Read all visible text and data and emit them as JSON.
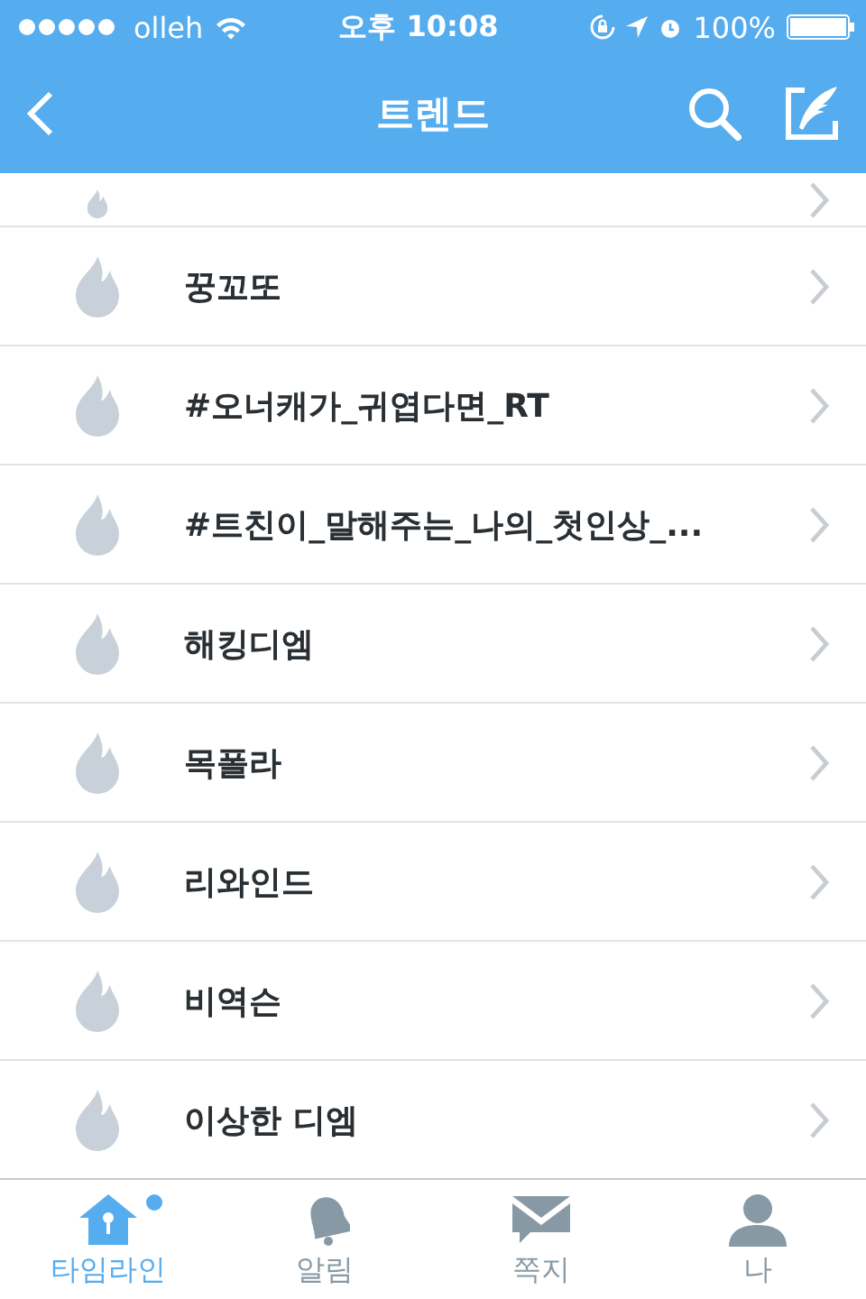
{
  "status_bar": {
    "carrier": "olleh",
    "time": "오후 10:08",
    "battery": "100%"
  },
  "nav": {
    "title": "트렌드"
  },
  "trends": [
    {
      "label": "꿍꼬또"
    },
    {
      "label": "#오너캐가_귀엽다면_RT"
    },
    {
      "label": "#트친이_말해주는_나의_첫인상_..."
    },
    {
      "label": "해킹디엠"
    },
    {
      "label": "목폴라"
    },
    {
      "label": "리와인드"
    },
    {
      "label": "비역슨"
    },
    {
      "label": "이상한 디엠"
    }
  ],
  "tab_bar": [
    {
      "kind": "home",
      "label": "타임라인",
      "selected": true,
      "badge": true
    },
    {
      "kind": "bell",
      "label": "알림",
      "selected": false,
      "badge": false
    },
    {
      "kind": "mail",
      "label": "쪽지",
      "selected": false,
      "badge": false
    },
    {
      "kind": "person",
      "label": "나",
      "selected": false,
      "badge": false
    }
  ]
}
